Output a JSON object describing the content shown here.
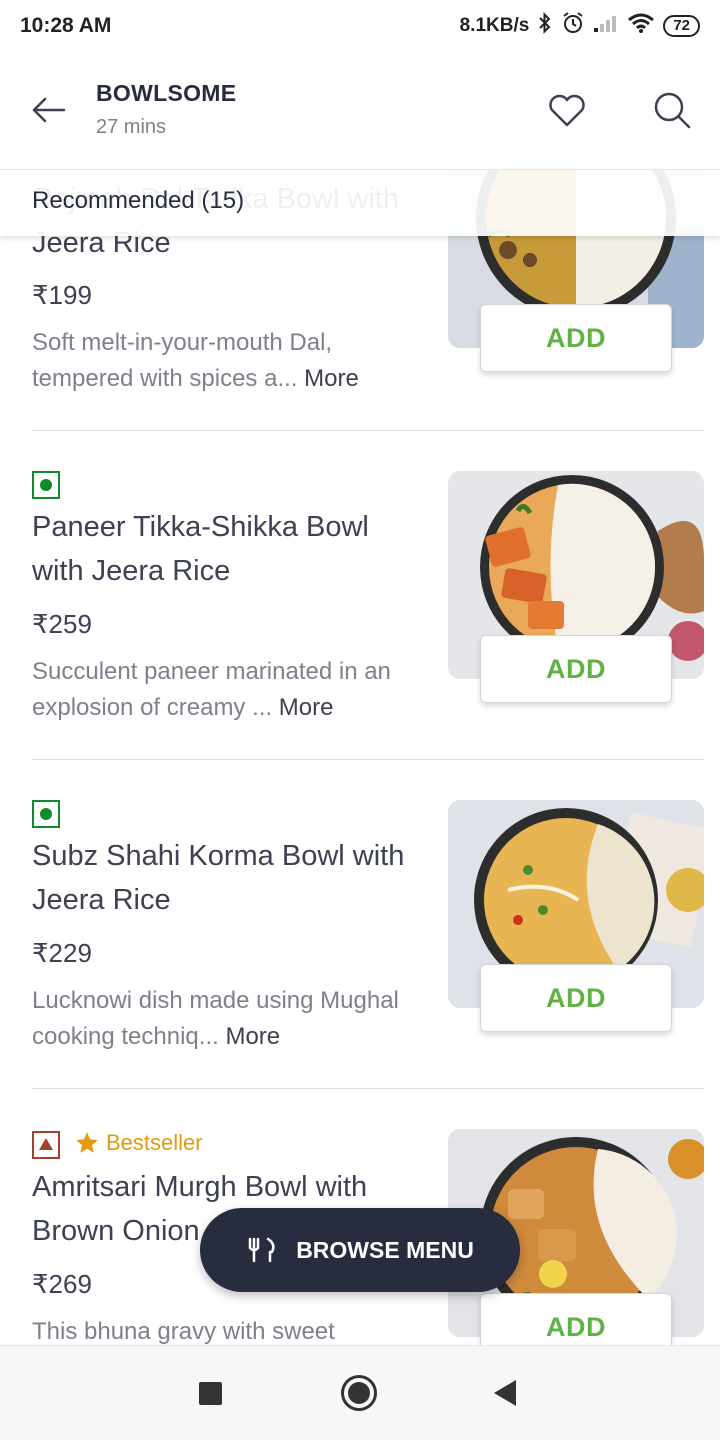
{
  "status_bar": {
    "time": "10:28 AM",
    "net_speed": "8.1KB/s",
    "battery": "72"
  },
  "header": {
    "title": "BOWLSOME",
    "subtitle": "27 mins"
  },
  "section": {
    "title": "Recommended (15)"
  },
  "items": [
    {
      "name": "Rajmah Dal Tadka Bowl with Jeera Rice",
      "price": "₹199",
      "desc": "Soft melt-in-your-mouth Dal, tempered with spices a...",
      "more": "More",
      "add": "ADD",
      "veg": true
    },
    {
      "name": "Paneer Tikka-Shikka Bowl with Jeera Rice",
      "price": "₹259",
      "desc": "Succulent paneer marinated in an explosion of creamy ...",
      "more": "More",
      "add": "ADD",
      "veg": true
    },
    {
      "name": "Subz Shahi Korma Bowl with Jeera Rice",
      "price": "₹229",
      "desc": "Lucknowi dish made using Mughal cooking techniq...",
      "more": "More",
      "add": "ADD",
      "veg": true
    },
    {
      "name": "Amritsari Murgh Bowl with Brown Onion",
      "price": "₹269",
      "desc": "This bhuna gravy with sweet",
      "add": "ADD",
      "veg": false,
      "tag": "Bestseller"
    }
  ],
  "browse": {
    "label": "BROWSE MENU"
  },
  "colors": {
    "accent_green": "#60b246",
    "veg": "#0f8a2c",
    "nonveg": "#a4412c",
    "bestseller": "#e39c0f",
    "dark": "#282c3f"
  }
}
